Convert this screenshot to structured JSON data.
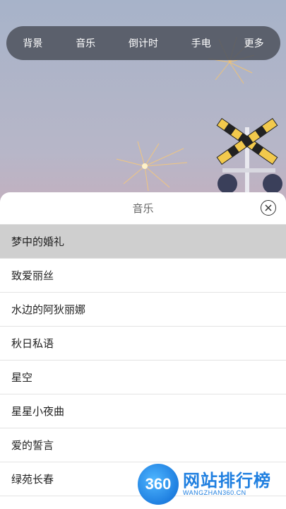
{
  "toolbar": {
    "items": [
      {
        "label": "背景"
      },
      {
        "label": "音乐"
      },
      {
        "label": "倒计时"
      },
      {
        "label": "手电"
      },
      {
        "label": "更多"
      }
    ]
  },
  "sheet": {
    "title": "音乐",
    "close_icon": "close-circle-icon",
    "selected_index": 0,
    "songs": [
      {
        "title": "梦中的婚礼"
      },
      {
        "title": "致爱丽丝"
      },
      {
        "title": "水边的阿狄丽娜"
      },
      {
        "title": "秋日私语"
      },
      {
        "title": "星空"
      },
      {
        "title": "星星小夜曲"
      },
      {
        "title": "爱的誓言"
      },
      {
        "title": "绿苑长春"
      }
    ]
  },
  "watermark": {
    "logo_text": "360",
    "title": "网站排行榜",
    "subtitle": "WANGZHAN360.CN"
  },
  "colors": {
    "toolbar_bg": "#50545e",
    "selected_row": "#cfcfcf",
    "watermark_blue": "#1f7fe0"
  }
}
